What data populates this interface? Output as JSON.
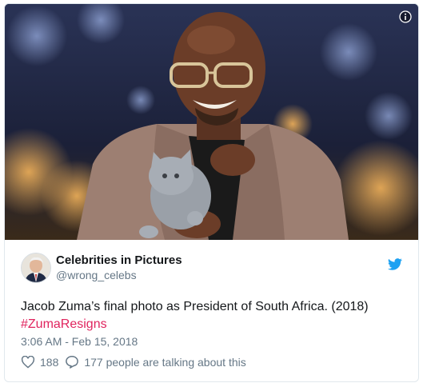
{
  "tweet": {
    "display_name": "Celebrities in Pictures",
    "handle": "@wrong_celebs",
    "text": "Jacob Zuma’s final photo as President of South Africa. (2018)",
    "hashtag": "#ZumaResigns",
    "timestamp": "3:06 AM - Feb 15, 2018",
    "like_count": "188",
    "conversation_label": "177 people are talking about this"
  },
  "icons": {
    "info": "info-icon",
    "brand": "twitter-bird-icon",
    "like": "heart-icon",
    "reply": "speech-bubble-icon"
  },
  "colors": {
    "hashtag": "#e0245e",
    "twitter_blue": "#1da1f2",
    "secondary_text": "#657786"
  }
}
